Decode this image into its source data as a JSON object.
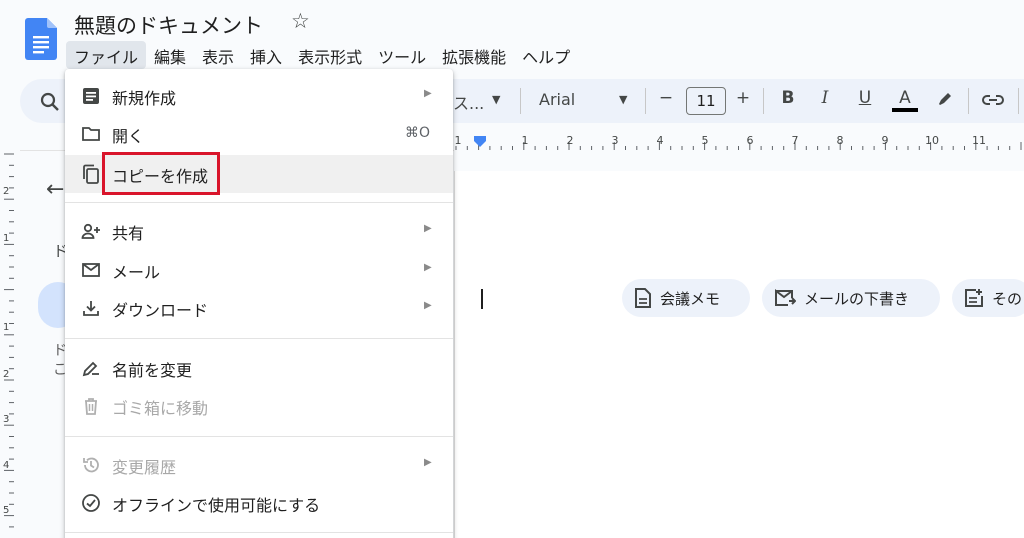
{
  "header": {
    "doc_title": "無題のドキュメント",
    "star_icon": "star-outline-icon"
  },
  "menubar": {
    "items": [
      "ファイル",
      "編集",
      "表示",
      "挿入",
      "表示形式",
      "ツール",
      "拡張機能",
      "ヘルプ"
    ],
    "active": "ファイル"
  },
  "toolbar": {
    "style_text": "ス...",
    "font": "Arial",
    "font_size": "11",
    "minus": "−",
    "plus": "+",
    "bold": "B",
    "italic": "I",
    "underline": "U",
    "text_color": "A",
    "text_color_value": "#000000"
  },
  "ruler": {
    "labels": [
      "1",
      "1",
      "2",
      "3",
      "4",
      "5",
      "6",
      "7",
      "8",
      "9",
      "10",
      "11"
    ],
    "vertical_labels": [
      "2",
      "1",
      "1",
      "2",
      "3",
      "4",
      "5"
    ]
  },
  "left_panel": {
    "back_icon": "arrow-left-icon",
    "text_d1": "ド",
    "text_t1": "ド",
    "text_t2": "こ"
  },
  "chips": [
    {
      "label": "会議メモ",
      "icon": "document-icon"
    },
    {
      "label": "メールの下書き",
      "icon": "mail-draft-icon"
    },
    {
      "label": "その",
      "icon": "note-add-icon"
    }
  ],
  "file_menu": {
    "items": [
      {
        "label": "新規作成",
        "icon": "document-icon",
        "submenu": true
      },
      {
        "label": "開く",
        "icon": "folder-icon",
        "shortcut": "⌘O"
      },
      {
        "label": "コピーを作成",
        "icon": "copy-icon",
        "highlighted": true
      },
      {
        "label": "共有",
        "icon": "person-add-icon",
        "submenu": true
      },
      {
        "label": "メール",
        "icon": "mail-icon",
        "submenu": true
      },
      {
        "label": "ダウンロード",
        "icon": "download-icon",
        "submenu": true
      },
      {
        "label": "名前を変更",
        "icon": "rename-icon"
      },
      {
        "label": "ゴミ箱に移動",
        "icon": "trash-icon",
        "disabled": true
      },
      {
        "label": "変更履歴",
        "icon": "history-icon",
        "submenu": true,
        "disabled": true
      },
      {
        "label": "オフラインで使用可能にする",
        "icon": "offline-check-icon"
      }
    ]
  },
  "colors": {
    "accent_blue": "#4285f4",
    "highlight_red": "#d9152b",
    "toolbar_bg": "#edf2fa"
  }
}
